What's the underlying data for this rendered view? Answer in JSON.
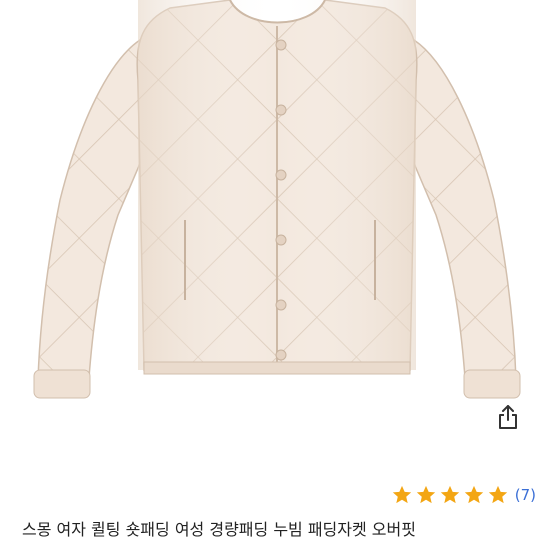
{
  "product": {
    "title": "스몽 여자 퀼팅 숏패딩 여성 경량패딩 누빔 패딩자켓 오버핏",
    "rating_stars": 5,
    "review_count_text": "(7)",
    "image_subject": "cream quilted padded jacket"
  },
  "icons": {
    "share": "share-icon",
    "star": "star-icon"
  },
  "colors": {
    "jacket": "#f2e7dc",
    "jacket_shadow": "#d9c8b8",
    "star": "#f3a614",
    "link": "#3b6fd6",
    "title_text": "#222222"
  }
}
